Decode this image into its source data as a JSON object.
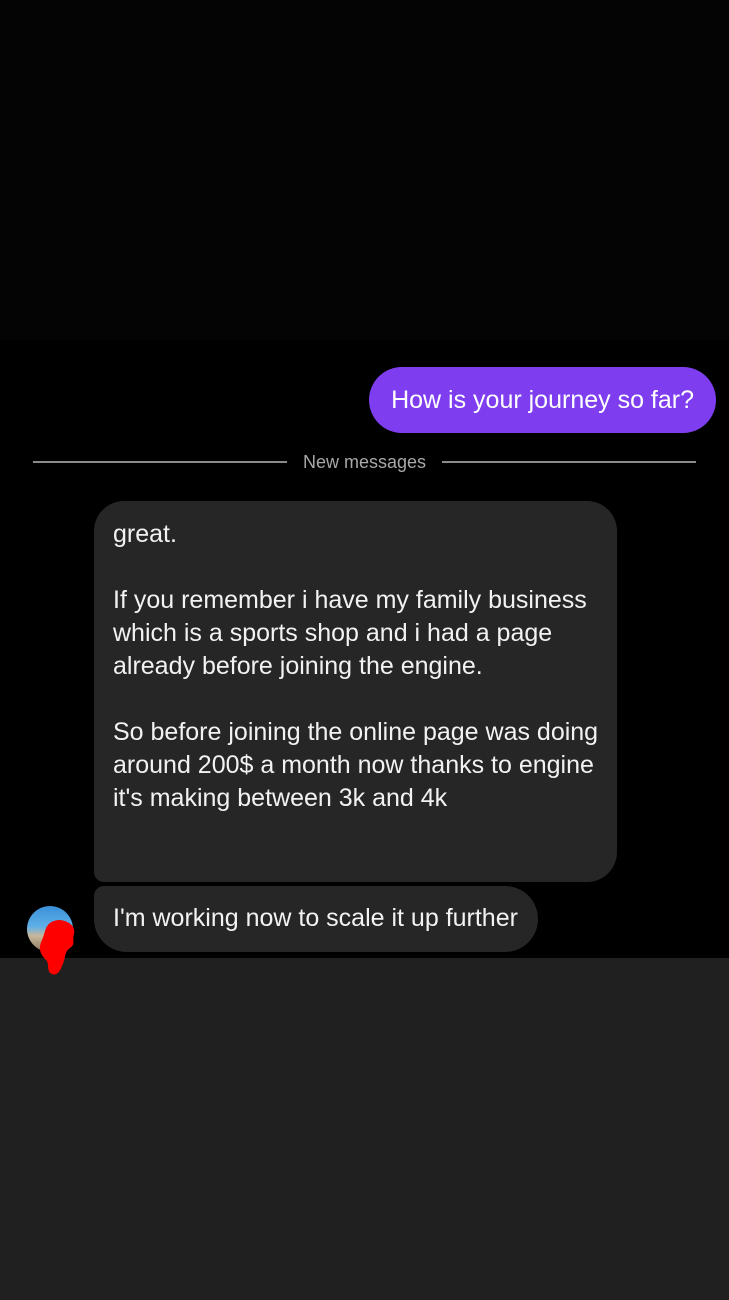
{
  "colors": {
    "outgoing_bubble": "#7e3ef0",
    "incoming_bubble": "#262626",
    "background": "#000000",
    "composer_area": "#202020",
    "redaction_mark": "#ff0000"
  },
  "conversation": {
    "outgoing": [
      {
        "text": "How is your journey so far?"
      }
    ],
    "divider": {
      "label": "New messages"
    },
    "incoming": [
      {
        "paragraphs": [
          "great.",
          "If you remember i have my family business which is a sports shop and i had a page already before joining the engine.",
          "So before joining the online page was doing around 200$ a month now thanks to engine it's making between 3k and 4k"
        ]
      },
      {
        "text": "I'm working now to scale it up further"
      }
    ],
    "sender_avatar": {
      "icon": "profile-avatar",
      "redacted": true
    }
  }
}
